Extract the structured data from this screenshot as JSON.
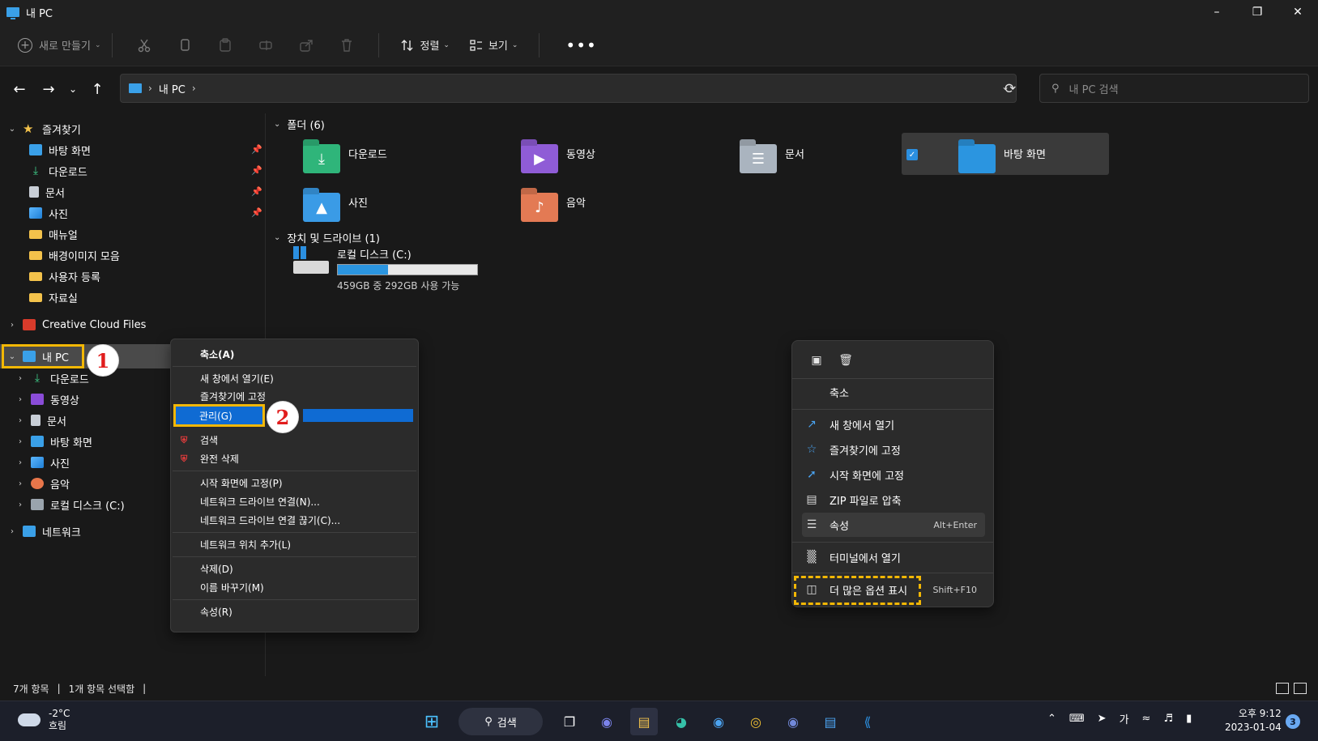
{
  "window": {
    "title": "내 PC"
  },
  "toolbar": {
    "new_label": "새로 만들기",
    "sort_label": "정렬",
    "view_label": "보기"
  },
  "address": {
    "crumb": "내 PC",
    "search_placeholder": "내 PC 검색"
  },
  "sidebar": {
    "favorites_label": "즐겨찾기",
    "favorites": [
      {
        "label": "바탕 화면",
        "icon": "desktop-icon",
        "pinned": true
      },
      {
        "label": "다운로드",
        "icon": "download-icon",
        "pinned": true
      },
      {
        "label": "문서",
        "icon": "document-icon",
        "pinned": true
      },
      {
        "label": "사진",
        "icon": "picture-icon",
        "pinned": true
      },
      {
        "label": "매뉴얼",
        "icon": "folder-icon"
      },
      {
        "label": "배경이미지 모음",
        "icon": "folder-icon"
      },
      {
        "label": "사용자 등록",
        "icon": "folder-icon"
      },
      {
        "label": "자료실",
        "icon": "folder-icon"
      }
    ],
    "creative_cloud": "Creative Cloud Files",
    "mypc_label": "내 PC",
    "mypc_children": [
      {
        "label": "다운로드",
        "icon": "download-icon"
      },
      {
        "label": "동영상",
        "icon": "video-icon"
      },
      {
        "label": "문서",
        "icon": "document-icon"
      },
      {
        "label": "바탕 화면",
        "icon": "desktop-icon"
      },
      {
        "label": "사진",
        "icon": "picture-icon"
      },
      {
        "label": "음악",
        "icon": "music-icon"
      },
      {
        "label": "로컬 디스크 (C:)",
        "icon": "disk-icon"
      }
    ],
    "network_label": "네트워크"
  },
  "main": {
    "folders_header": "폴더 (6)",
    "folders": [
      {
        "label": "다운로드",
        "icon": "download-folder-icon"
      },
      {
        "label": "동영상",
        "icon": "video-folder-icon"
      },
      {
        "label": "문서",
        "icon": "document-folder-icon"
      },
      {
        "label": "바탕 화면",
        "icon": "desktop-folder-icon",
        "selected": true
      },
      {
        "label": "사진",
        "icon": "picture-folder-icon"
      },
      {
        "label": "음악",
        "icon": "music-folder-icon"
      }
    ],
    "drives_header": "장치 및 드라이브 (1)",
    "drive": {
      "name": "로컬 디스크 (C:)",
      "free_text": "459GB 중 292GB 사용 가능",
      "used_fraction": 0.36
    }
  },
  "status": {
    "count": "7개 항목",
    "selected": "1개 항목 선택함"
  },
  "ctx_menu_classic": {
    "collapse": "축소(A)",
    "open_new_window": "새 창에서 열기(E)",
    "pin_favorites": "즐겨찾기에 고정",
    "manage": "관리(G)",
    "search": "검색",
    "full_delete": "완전 삭제",
    "pin_start": "시작 화면에 고정(P)",
    "map_drive": "네트워크 드라이브 연결(N)...",
    "disconnect_drive": "네트워크 드라이브 연결 끊기(C)...",
    "add_net_location": "네트워크 위치 추가(L)",
    "delete": "삭제(D)",
    "rename": "이름 바꾸기(M)",
    "properties": "속성(R)"
  },
  "ctx_menu_modern": {
    "collapse": "축소",
    "open_new_window": "새 창에서 열기",
    "pin_favorites": "즐겨찾기에 고정",
    "pin_start": "시작 화면에 고정",
    "zip": "ZIP 파일로 압축",
    "properties": "속성",
    "properties_shortcut": "Alt+Enter",
    "terminal": "터미널에서 열기",
    "more_options": "더 많은 옵션 표시",
    "more_options_shortcut": "Shift+F10"
  },
  "annotations": {
    "badge1": "1",
    "badge2": "2"
  },
  "taskbar": {
    "temp": "-2°C",
    "weather": "흐림",
    "search_label": "검색",
    "ime": "가",
    "time": "오후 9:12",
    "date": "2023-01-04",
    "notif_count": "3"
  },
  "colors": {
    "accent": "#0f6bd3",
    "highlight_box": "#f2b705",
    "badge_text": "#e11d1d"
  }
}
